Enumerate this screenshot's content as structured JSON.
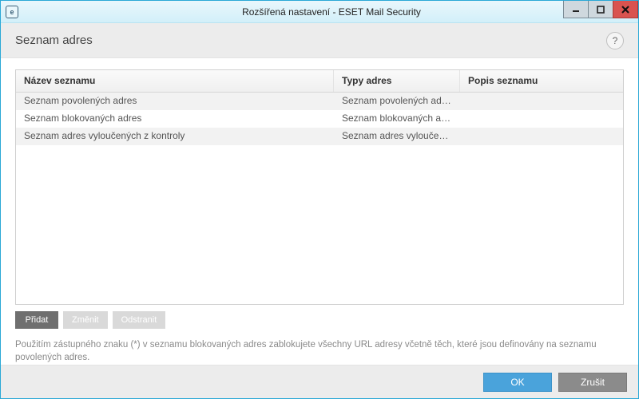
{
  "window": {
    "title": "Rozšířená nastavení - ESET Mail Security"
  },
  "section": {
    "title": "Seznam adres",
    "help_tooltip": "?"
  },
  "grid": {
    "headers": {
      "name": "Název seznamu",
      "types": "Typy adres",
      "desc": "Popis seznamu"
    },
    "rows": [
      {
        "name": "Seznam povolených adres",
        "types": "Seznam povolených adres",
        "desc": ""
      },
      {
        "name": "Seznam blokovaných adres",
        "types": "Seznam blokovaných ad...",
        "desc": ""
      },
      {
        "name": "Seznam adres vyloučených z kontroly",
        "types": "Seznam adres vyloučený...",
        "desc": ""
      }
    ]
  },
  "buttons": {
    "add": "Přidat",
    "edit": "Změnit",
    "remove": "Odstranit"
  },
  "hint": "Použitím zástupného znaku (*) v seznamu blokovaných adres zablokujete všechny URL adresy včetně těch, které jsou definovány na seznamu povolených adres.",
  "footer": {
    "ok": "OK",
    "cancel": "Zrušit"
  }
}
